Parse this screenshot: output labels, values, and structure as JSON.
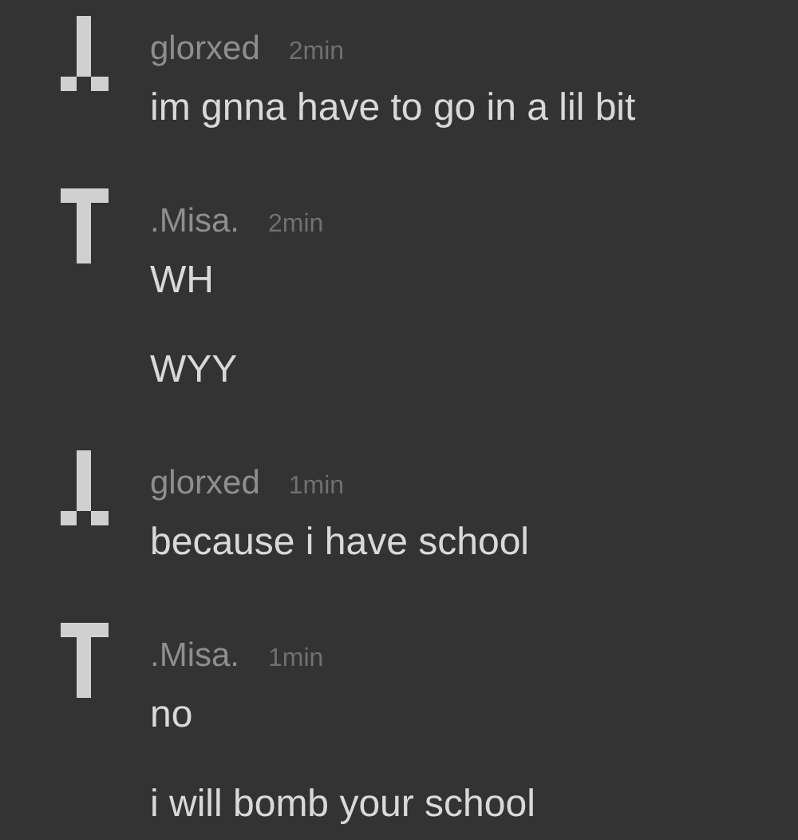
{
  "messages": [
    {
      "author": "glorxed",
      "kind": "down",
      "time": "2min",
      "lines": [
        "im gnna have to go in a lil bit"
      ]
    },
    {
      "author": ".Misa.",
      "kind": "up",
      "time": "2min",
      "lines": [
        "WH",
        "WYY"
      ]
    },
    {
      "author": "glorxed",
      "kind": "down",
      "time": "1min",
      "lines": [
        "because i have school"
      ]
    },
    {
      "author": ".Misa.",
      "kind": "up",
      "time": "1min",
      "lines": [
        "no",
        "i will bomb your school"
      ]
    }
  ]
}
